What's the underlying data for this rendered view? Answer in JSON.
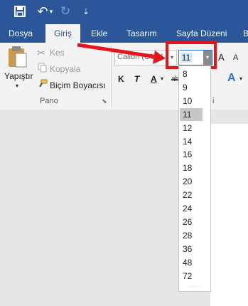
{
  "qat": {
    "undo_glyph": "↶",
    "undo_caret": "▾",
    "redo_glyph": "↻",
    "customize_glyph": "⇣"
  },
  "tabs": [
    "Dosya",
    "Giriş",
    "Ekle",
    "Tasarım",
    "Sayfa Düzeni",
    "B"
  ],
  "clipboard": {
    "paste_label": "Yapıştır",
    "paste_caret": "▾",
    "cut_label": "Kes",
    "copy_label": "Kopyala",
    "format_painter_label": "Biçim Boyacısı",
    "group_label": "Pano",
    "launcher_glyph": "⬊"
  },
  "font": {
    "name": "Calibri (Gövd",
    "size": "11",
    "bold": "K",
    "italic": "T",
    "underline": "A",
    "strike": "ab",
    "grow": "A",
    "shrink": "A",
    "text_effects": "A",
    "group_label_fragment": "i"
  },
  "size_options": [
    "8",
    "9",
    "10",
    "11",
    "12",
    "14",
    "16",
    "18",
    "20",
    "22",
    "24",
    "26",
    "28",
    "36",
    "48",
    "72"
  ],
  "selected_size": "11",
  "grip": "·····",
  "colors": {
    "ribbon_blue": "#2b579a",
    "highlight_red": "#e8141b"
  }
}
